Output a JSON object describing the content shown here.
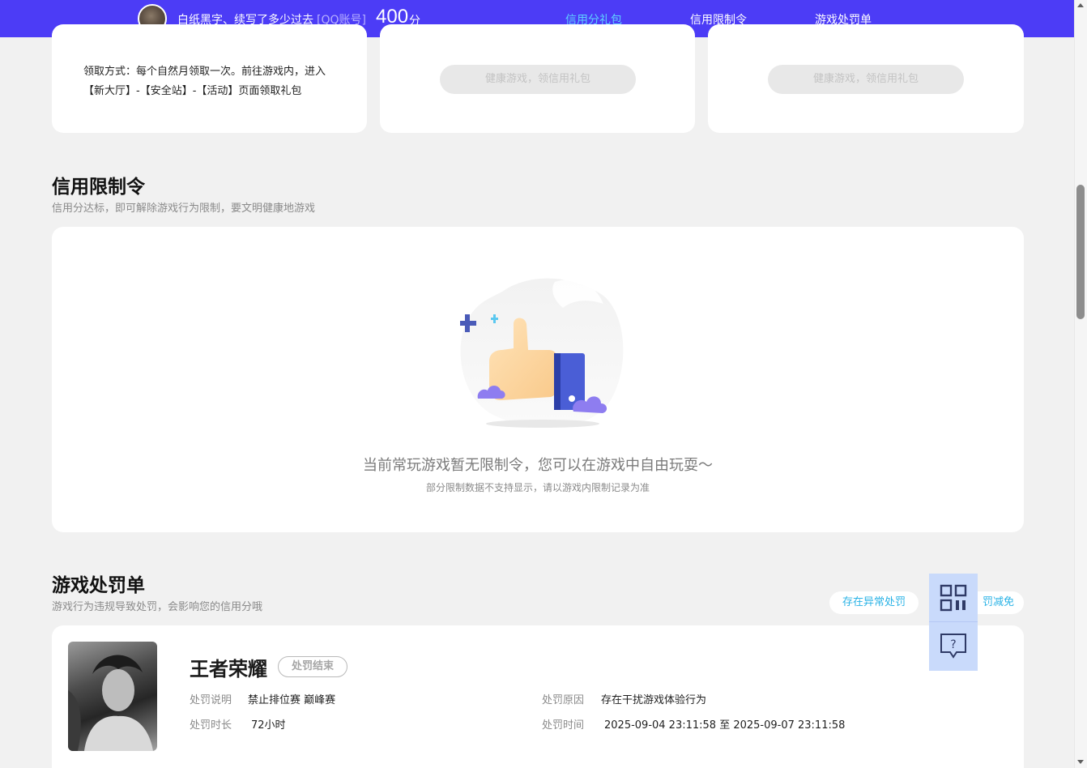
{
  "header": {
    "nickname": "白纸黑字、续写了多少过去",
    "account_type": "[QQ账号]",
    "score": "400",
    "score_unit": "分",
    "nav": [
      "信用分礼包",
      "信用限制令",
      "游戏处罚单"
    ],
    "active_color": "#5fd0ff",
    "bar_color": "#4c3cf6"
  },
  "gifts": {
    "claim_desc": "领取方式：每个自然月领取一次。前往游戏内，进入【新大厅】-【安全站】-【活动】页面领取礼包",
    "button_label": "健康游戏，领信用礼包"
  },
  "restriction": {
    "title": "信用限制令",
    "subtitle": "信用分达标，即可解除游戏行为限制，要文明健康地游戏",
    "empty_text": "当前常玩游戏暂无限制令，您可以在游戏中自由玩耍～",
    "empty_note": "部分限制数据不支持显示，请以游戏内限制记录为准"
  },
  "penalty": {
    "title": "游戏处罚单",
    "subtitle": "游戏行为违规导致处罚，会影响您的信用分哦",
    "link_abnormal": "存在异常处罚",
    "link_reduce": "罚减免",
    "game": "王者荣耀",
    "status": "处罚结束",
    "label_desc": "处罚说明",
    "value_desc": "禁止排位赛 巅峰赛",
    "label_duration": "处罚时长",
    "value_duration": "72小时",
    "label_reason": "处罚原因",
    "value_reason": "存在干扰游戏体验行为",
    "label_time": "处罚时间",
    "value_time": "2025-09-04 23:11:58 至 2025-09-07 23:11:58"
  },
  "float": {
    "icons": [
      "qrcode-icon",
      "feedback-icon"
    ],
    "feedback_glyph": "?"
  }
}
